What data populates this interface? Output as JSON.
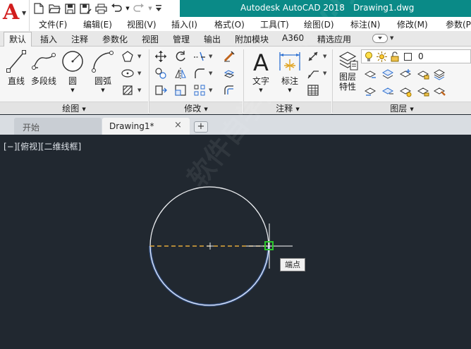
{
  "titlebar": {
    "app_name": "Autodesk AutoCAD 2018",
    "document": "Drawing1.dwg"
  },
  "qat_icons": [
    "new-file-icon",
    "open-folder-icon",
    "save-icon",
    "save-as-icon",
    "print-icon",
    "undo-icon",
    "redo-icon"
  ],
  "menu": [
    {
      "label": "文件(F)"
    },
    {
      "label": "编辑(E)"
    },
    {
      "label": "视图(V)"
    },
    {
      "label": "插入(I)"
    },
    {
      "label": "格式(O)"
    },
    {
      "label": "工具(T)"
    },
    {
      "label": "绘图(D)"
    },
    {
      "label": "标注(N)"
    },
    {
      "label": "修改(M)"
    },
    {
      "label": "参数(P"
    }
  ],
  "ribbon_tabs": [
    {
      "label": "默认",
      "active": true
    },
    {
      "label": "插入"
    },
    {
      "label": "注释"
    },
    {
      "label": "参数化"
    },
    {
      "label": "视图"
    },
    {
      "label": "管理"
    },
    {
      "label": "输出"
    },
    {
      "label": "附加模块"
    },
    {
      "label": "A360"
    },
    {
      "label": "精选应用"
    }
  ],
  "draw_panel": {
    "title": "绘图",
    "tools": {
      "line": "直线",
      "polyline": "多段线",
      "circle": "圆",
      "arc": "圆弧"
    }
  },
  "modify_panel": {
    "title": "修改"
  },
  "annotation_panel": {
    "title": "注释",
    "tools": {
      "text": "文字",
      "dimension": "标注"
    }
  },
  "layers_panel": {
    "title": "图层",
    "tools": {
      "layer_properties": "图层\n特性"
    },
    "current_layer": "0"
  },
  "doc_tabs": {
    "start": "开始",
    "current": "Drawing1*",
    "close": "×",
    "add": "+"
  },
  "viewport": {
    "label": "[−][俯视][二维线框]",
    "tooltip": "端点"
  },
  "watermark": "软件自学网 www.rjzxw.com",
  "colors": {
    "title_bar": "#0a8a87",
    "canvas": "#212830",
    "circle": "#e8eaed",
    "selected_arc": "#4d8dff",
    "snap_marker": "#2cc82c",
    "diameter_line": "#e3a93a"
  }
}
